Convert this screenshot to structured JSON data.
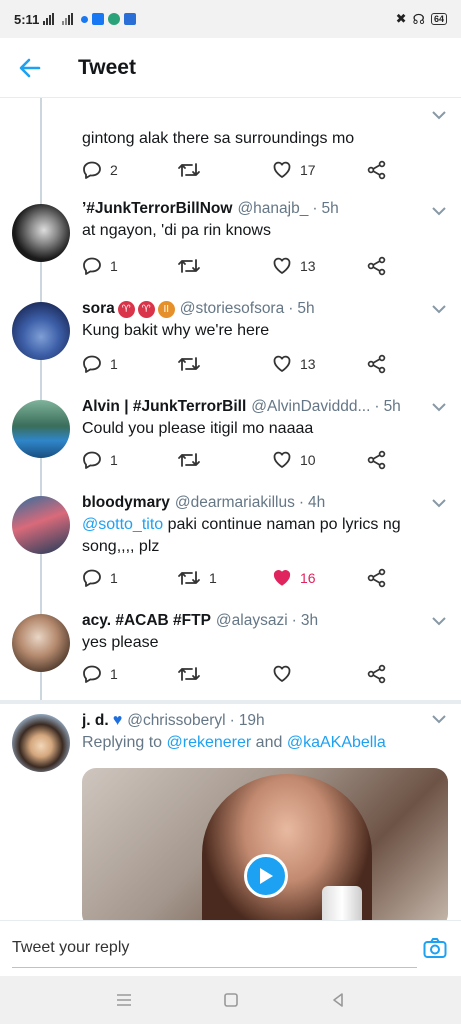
{
  "status_bar": {
    "time": "5:11",
    "battery": "64"
  },
  "header": {
    "title": "Tweet"
  },
  "partial_tweet": {
    "text": "gintong alak there sa surroundings mo",
    "replies": "2",
    "retweets": "",
    "likes": "17"
  },
  "tweets": [
    {
      "name": "’#JunkTerrorBillNow",
      "handle": "@hanajb_",
      "time": "5h",
      "text": "at ngayon, 'di pa rin knows",
      "replies": "1",
      "retweets": "",
      "likes": "13",
      "liked": false
    },
    {
      "name": "sora",
      "handle": "@storiesofsora",
      "time": "5h",
      "text": "Kung bakit why we're here",
      "replies": "1",
      "retweets": "",
      "likes": "13",
      "liked": false
    },
    {
      "name": "Alvin | #JunkTerrorBill",
      "handle": "@AlvinDaviddd...",
      "time": "5h",
      "text": "Could you please itigil mo naaaa",
      "replies": "1",
      "retweets": "",
      "likes": "10",
      "liked": false
    },
    {
      "name": "bloodymary",
      "handle": "@dearmariakillus",
      "time": "4h",
      "mention": "@sotto_tito",
      "text": " paki continue naman po lyrics ng song,,,, plz",
      "replies": "1",
      "retweets": "1",
      "likes": "16",
      "liked": true
    },
    {
      "name": "acy. #ACAB #FTP",
      "handle": "@alaysazi",
      "time": "3h",
      "text": "yes please",
      "replies": "1",
      "retweets": "",
      "likes": "",
      "liked": false
    }
  ],
  "reply_tweet": {
    "name": "j. d.",
    "handle": "@chrissoberyl",
    "time": "19h",
    "replying_prefix": "Replying to",
    "replying_to_1": "@rekenerer",
    "replying_and": "and",
    "replying_to_2": "@kaAKAbella"
  },
  "reply_bar": {
    "placeholder": "Tweet your reply"
  },
  "colors": {
    "accent": "#1da1f2",
    "like_active": "#e0245e"
  },
  "icons": [
    "back-arrow-icon",
    "chevron-down-icon",
    "reply-icon",
    "retweet-icon",
    "like-icon",
    "share-icon",
    "play-icon",
    "camera-icon"
  ]
}
